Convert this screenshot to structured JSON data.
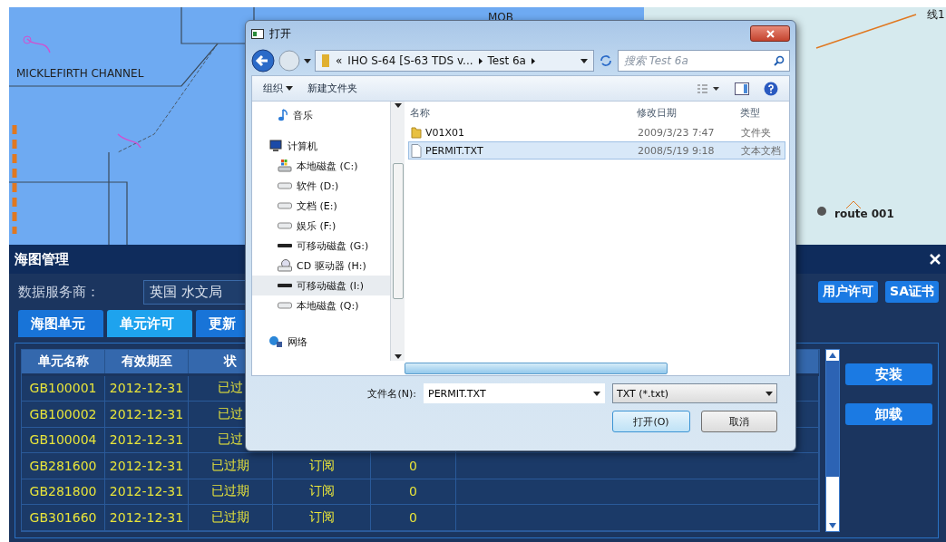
{
  "map": {
    "labels": [
      {
        "text": "MICKLEFIRTH CHANNEL"
      },
      {
        "text": "MOB"
      },
      {
        "text": "route 001"
      },
      {
        "text": "线1"
      }
    ]
  },
  "panel": {
    "title": "海图管理",
    "provider_label": "数据服务商：",
    "provider_value": "英国 水文局",
    "side_buttons": [
      "用户许可",
      "SA证书"
    ],
    "tabs": [
      {
        "label": "海图单元",
        "selected": false
      },
      {
        "label": "单元许可",
        "selected": true
      },
      {
        "label": "更新",
        "selected": false
      }
    ],
    "table": {
      "columns": [
        "单元名称",
        "有效期至",
        "状"
      ],
      "rows": [
        {
          "cells": [
            "GB100001",
            "2012-12-31",
            "已过"
          ]
        },
        {
          "cells": [
            "GB100002",
            "2012-12-31",
            "已过"
          ]
        },
        {
          "cells": [
            "GB100004",
            "2012-12-31",
            "已过"
          ]
        },
        {
          "cells": [
            "GB281600",
            "2012-12-31",
            "已过期",
            "订阅",
            "0"
          ]
        },
        {
          "cells": [
            "GB281800",
            "2012-12-31",
            "已过期",
            "订阅",
            "0"
          ]
        },
        {
          "cells": [
            "GB301660",
            "2012-12-31",
            "已过期",
            "订阅",
            "0"
          ]
        }
      ]
    },
    "actions": [
      "安装",
      "卸载"
    ]
  },
  "dialog": {
    "title": "打开",
    "path_overflow": "«",
    "path": [
      "IHO S-64 [S-63 TDS v...",
      "Test 6a"
    ],
    "search": {
      "placeholder": "搜索 Test 6a"
    },
    "toolbar": [
      "组织",
      "新建文件夹"
    ],
    "nav": [
      {
        "label": "音乐",
        "kind": "music",
        "selected": false
      },
      {
        "label": "计算机",
        "kind": "computer",
        "selected": false
      },
      {
        "label": "本地磁盘 (C:)",
        "kind": "system",
        "selected": false
      },
      {
        "label": "软件 (D:)",
        "kind": "drive",
        "selected": false
      },
      {
        "label": "文档 (E:)",
        "kind": "drive",
        "selected": false
      },
      {
        "label": "娱乐 (F:)",
        "kind": "drive",
        "selected": false
      },
      {
        "label": "可移动磁盘 (G:)",
        "kind": "removable",
        "selected": false
      },
      {
        "label": "CD 驱动器 (H:)",
        "kind": "cd",
        "selected": false
      },
      {
        "label": "可移动磁盘 (I:)",
        "kind": "removable",
        "selected": true
      },
      {
        "label": "本地磁盘 (Q:)",
        "kind": "drive",
        "selected": false
      },
      {
        "label": "网络",
        "kind": "network",
        "selected": false
      }
    ],
    "columns": [
      "名称",
      "修改日期",
      "类型"
    ],
    "files": [
      {
        "name": "V01X01",
        "date": "2009/3/23 7:47",
        "type": "文件夹",
        "kind": "folder",
        "selected": false
      },
      {
        "name": "PERMIT.TXT",
        "date": "2008/5/19 9:18",
        "type": "文本文档",
        "kind": "text",
        "selected": true
      }
    ],
    "filename_label": "文件名(N):",
    "filename": "PERMIT.TXT",
    "filter": "TXT (*.txt)",
    "buttons": [
      "打开(O)",
      "取消"
    ]
  }
}
